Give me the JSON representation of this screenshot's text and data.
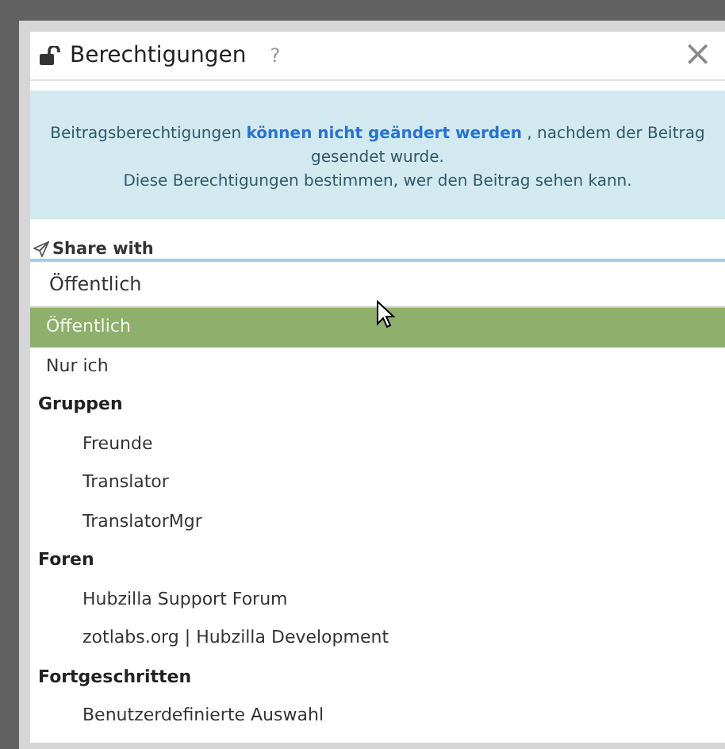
{
  "dialog": {
    "title": "Berechtigungen",
    "help": "?",
    "close": "×"
  },
  "notice": {
    "lines": [
      "Beitragsberechtigungen **können nicht geändert werden** , nachdem der Beitrag gesendet wurde.",
      "Diese Berechtigungen bestimmen, wer den Beitrag sehen kann."
    ]
  },
  "share": {
    "label": "Share with",
    "value": "Öffentlich"
  },
  "options": [
    {
      "kind": "option",
      "label": "Öffentlich",
      "selected": true
    },
    {
      "kind": "option",
      "label": "Nur ich",
      "selected": false
    },
    {
      "kind": "group",
      "label": "Gruppen",
      "children": [
        {
          "label": "Freunde",
          "selected": false
        },
        {
          "label": "Translator",
          "selected": false
        },
        {
          "label": "TranslatorMgr",
          "selected": false
        }
      ]
    },
    {
      "kind": "group",
      "label": "Foren",
      "children": [
        {
          "label": "Hubzilla Support Forum",
          "selected": false
        },
        {
          "label": "zotlabs.org | Hubzilla Development",
          "selected": false
        }
      ]
    },
    {
      "kind": "group",
      "label": "Fortgeschritten",
      "children": [
        {
          "label": "Benutzerdefinierte Auswahl",
          "selected": false
        }
      ]
    }
  ]
}
